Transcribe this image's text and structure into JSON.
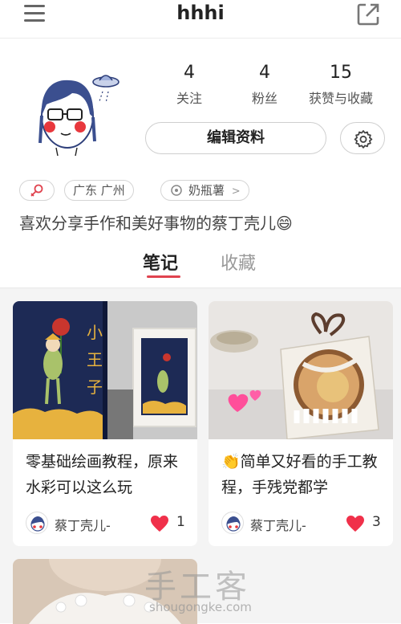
{
  "header": {
    "title": "hhhi"
  },
  "profile": {
    "stats": [
      {
        "value": "4",
        "label": "关注"
      },
      {
        "value": "4",
        "label": "粉丝"
      },
      {
        "value": "15",
        "label": "获赞与收藏"
      }
    ],
    "edit_label": "编辑资料",
    "tags": {
      "location": "广东  广州",
      "constellation": "奶瓶薯"
    },
    "tag_arrow": ">",
    "bio": "喜欢分享手作和美好事物的蔡丁壳儿😄"
  },
  "tabs": [
    {
      "label": "笔记"
    },
    {
      "label": "收藏"
    }
  ],
  "colors": {
    "accent": "#e0434f",
    "heart": "#f0304a"
  },
  "notes": [
    {
      "title": "零基础绘画教程，原来水彩可以这么玩",
      "author": "蔡丁壳儿-",
      "likes": "1"
    },
    {
      "title": "👏简单又好看的手工教程，手残党都学",
      "author": "蔡丁壳儿-",
      "likes": "3"
    }
  ],
  "watermark": {
    "cn": "手工客",
    "url": "shougongke.com"
  }
}
